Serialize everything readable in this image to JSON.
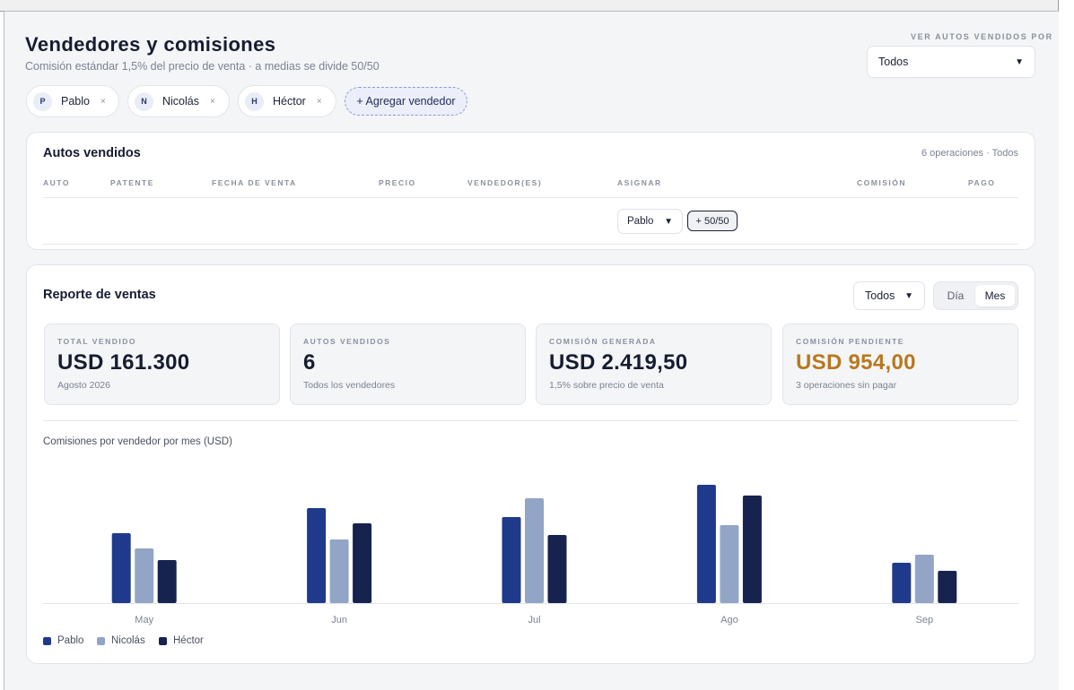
{
  "header": {
    "title": "Vendedores y comisiones",
    "subtitle": "Comisión estándar 1,5% del precio de venta · a medias se divide 50/50",
    "filter_label": "VER AUTOS VENDIDOS POR",
    "filter_value": "Todos"
  },
  "sellers": [
    {
      "initial": "P",
      "name": "Pablo",
      "remove": "×"
    },
    {
      "initial": "N",
      "name": "Nicolás",
      "remove": "×"
    },
    {
      "initial": "H",
      "name": "Héctor",
      "remove": "×"
    }
  ],
  "add_seller_label": "+ Agregar vendedor",
  "sold_cars": {
    "title": "Autos vendidos",
    "meta": "6 operaciones · Todos",
    "columns": [
      "AUTO",
      "PATENTE",
      "FECHA DE VENTA",
      "PRECIO",
      "VENDEDOR(ES)",
      "ASIGNAR",
      "COMISIÓN",
      "PAGO"
    ],
    "assign_select": "Pablo",
    "split_button": "+ 50/50"
  },
  "report": {
    "title": "Reporte de ventas",
    "filter_value": "Todos",
    "toggle": [
      "Día",
      "Mes"
    ],
    "toggle_active": "Mes",
    "stats": [
      {
        "label": "TOTAL VENDIDO",
        "value": "USD 161.300",
        "sub": "Agosto 2026",
        "color": "#161c30"
      },
      {
        "label": "AUTOS VENDIDOS",
        "value": "6",
        "sub": "Todos los vendedores",
        "color": "#161c30"
      },
      {
        "label": "COMISIÓN GENERADA",
        "value": "USD 2.419,50",
        "sub": "1,5% sobre precio de venta",
        "color": "#161c30"
      },
      {
        "label": "COMISIÓN PENDIENTE",
        "value": "USD 954,00",
        "sub": "3 operaciones sin pagar",
        "color": "#b8781f"
      }
    ],
    "chart_title": "Comisiones por vendedor por mes (USD)"
  },
  "chart_data": {
    "type": "bar",
    "title": "Comisiones por vendedor por mes (USD)",
    "categories": [
      "May",
      "Jun",
      "Jul",
      "Ago",
      "Sep"
    ],
    "series": [
      {
        "name": "Pablo",
        "color": "#1f3a8a",
        "values": [
          78,
          106,
          96,
          132,
          45
        ]
      },
      {
        "name": "Nicolás",
        "color": "#93a5c6",
        "values": [
          61,
          71,
          117,
          87,
          54
        ]
      },
      {
        "name": "Héctor",
        "color": "#17234f",
        "values": [
          48,
          89,
          76,
          120,
          36
        ]
      }
    ],
    "ylim": [
      0,
      132
    ],
    "grid": false,
    "legend": "bottom-left"
  }
}
